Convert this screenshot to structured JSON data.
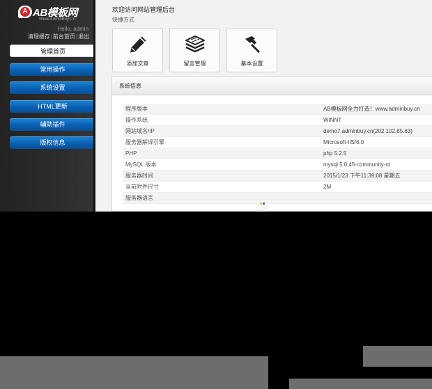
{
  "sidebar": {
    "logo_text": "AB模板网",
    "logo_letter": "A",
    "logo_sub": "Www.AdminBuy.Cn",
    "greeting": "Hello, admin",
    "links": [
      "清理缓存",
      "前台首页",
      "退出"
    ],
    "menu": [
      {
        "label": "管理首页",
        "active": true
      },
      {
        "label": "常用操作",
        "active": false
      },
      {
        "label": "系统设置",
        "active": false
      },
      {
        "label": "HTML更新",
        "active": false
      },
      {
        "label": "辅助插件",
        "active": false
      },
      {
        "label": "版权信息",
        "active": false
      }
    ]
  },
  "main": {
    "welcome": "欢迎访问网站管理后台",
    "shortcut_title": "快捷方式",
    "shortcuts": [
      {
        "label": "添加文章",
        "icon": "pencil-icon"
      },
      {
        "label": "留言管理",
        "icon": "paper-stack-icon"
      },
      {
        "label": "基本设置",
        "icon": "hammer-icon"
      }
    ],
    "panel_title": "系统信息",
    "info": [
      {
        "key": "程序版本",
        "value": "AB模板网全力打造！www.adminbuy.cn"
      },
      {
        "key": "操作系统",
        "value": "WINNT"
      },
      {
        "key": "网站域名/IP",
        "value": "demo7.adminbuy.cn(202.102.85.63)"
      },
      {
        "key": "服务器解译引擎",
        "value": "Microsoft-IIS/6.0"
      },
      {
        "key": "PHP",
        "value": "php 5.2.5"
      },
      {
        "key": "MySQL 版本",
        "value": "mysql 5.0.45-community-nt"
      },
      {
        "key": "服务器时间",
        "value": "2015/1/23 下午11:39:08 星期五"
      },
      {
        "key": "当前附件尺寸",
        "value": "2M"
      },
      {
        "key": "服务器语言",
        "value": ""
      }
    ]
  },
  "colors": {
    "sidebar_bg": "#2c2c2c",
    "menu_blue": "#0a5fb2",
    "logo_red": "#d8222a",
    "main_bg": "#f2f2f2"
  }
}
